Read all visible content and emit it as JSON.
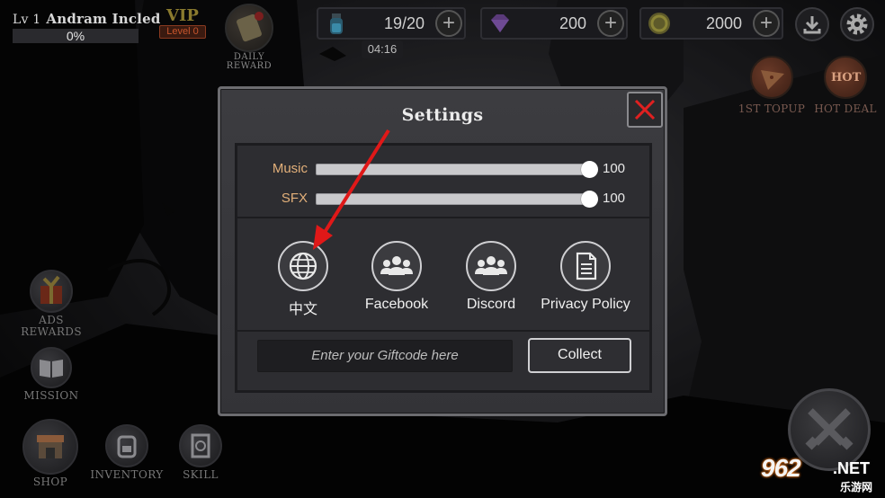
{
  "player": {
    "level_label": "Lv 1",
    "name": "Andram Incled",
    "xp_percent": "0%"
  },
  "vip": {
    "title": "VIP",
    "level": "Level 0"
  },
  "daily_reward": {
    "label_line1": "DAILY",
    "label_line2": "REWARD",
    "icon": "scroll-icon"
  },
  "resources": {
    "energy": {
      "value": "19/20",
      "icon": "potion-icon"
    },
    "gems": {
      "value": "200",
      "icon": "gem-icon"
    },
    "gold": {
      "value": "2000",
      "icon": "coin-icon"
    }
  },
  "timer": "04:16",
  "promos": {
    "topup": "1ST TOPUP",
    "hotdeal": "HOT DEAL",
    "hot_badge": "HOT"
  },
  "side_menu": {
    "ads_line1": "ADS",
    "ads_line2": "REWARDS",
    "mission": "MISSION",
    "shop": "SHOP",
    "inventory": "INVENTORY",
    "skill": "SKILL"
  },
  "settings": {
    "title": "Settings",
    "music": {
      "label": "Music",
      "value": "100",
      "level": 1.0
    },
    "sfx": {
      "label": "SFX",
      "value": "100",
      "level": 1.0
    },
    "options": {
      "language": "中文",
      "facebook": "Facebook",
      "discord": "Discord",
      "privacy": "Privacy Policy"
    },
    "giftcode_placeholder": "Enter your Giftcode here",
    "collect": "Collect"
  },
  "watermark": {
    "number": "962",
    "suffix": ".NET",
    "cn": "乐游网"
  },
  "colors": {
    "slider_label": "#e3b07a",
    "close_x": "#e02020",
    "arrow": "#e01818"
  }
}
